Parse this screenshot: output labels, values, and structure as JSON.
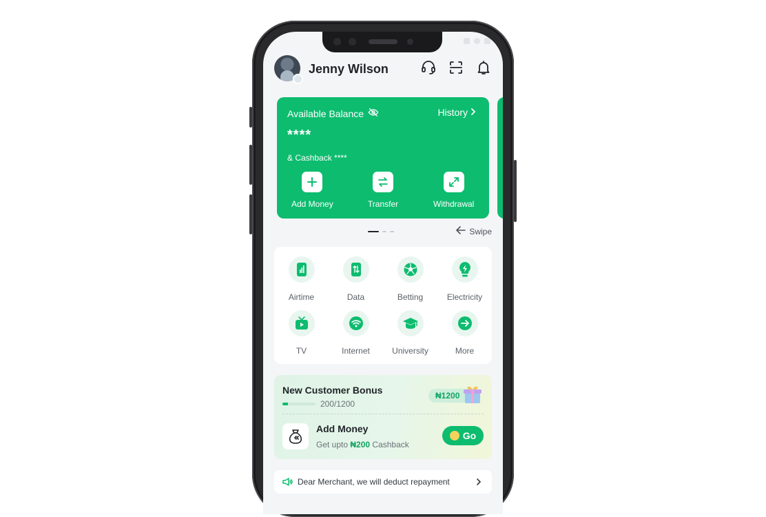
{
  "header": {
    "user_name": "Jenny Wilson"
  },
  "balance_card": {
    "label": "Available Balance",
    "history_label": "History",
    "balance": "****",
    "cashback": "& Cashback ****",
    "actions": [
      {
        "label": "Add Money",
        "icon": "plus-icon"
      },
      {
        "label": "Transfer",
        "icon": "transfer-arrows-icon"
      },
      {
        "label": "Withdrawal",
        "icon": "expand-arrows-icon"
      }
    ]
  },
  "pager": {
    "swipe_label": "Swipe",
    "pages": 3,
    "active_page": 1
  },
  "services": [
    {
      "label": "Airtime",
      "icon": "phone-signal-icon"
    },
    {
      "label": "Data",
      "icon": "data-transfer-icon"
    },
    {
      "label": "Betting",
      "icon": "soccer-ball-icon"
    },
    {
      "label": "Electricity",
      "icon": "lightbulb-icon"
    },
    {
      "label": "TV",
      "icon": "tv-icon"
    },
    {
      "label": "Internet",
      "icon": "wifi-icon"
    },
    {
      "label": "University",
      "icon": "graduation-cap-icon"
    },
    {
      "label": "More",
      "icon": "arrow-right-circle-icon"
    }
  ],
  "bonus": {
    "title": "New Customer Bonus",
    "progress_text": "200/1200",
    "progress_fraction": 0.1667,
    "reward_amount": "₦1200",
    "task": {
      "title": "Add Money",
      "subtitle_prefix": "Get upto ",
      "subtitle_amount": "₦200",
      "subtitle_suffix": " Cashback",
      "button_label": "Go"
    }
  },
  "notice": {
    "text": "Dear Merchant, we will deduct repayment"
  },
  "colors": {
    "brand_green": "#0dbc6f",
    "bubble_green": "#e8f6ef"
  }
}
